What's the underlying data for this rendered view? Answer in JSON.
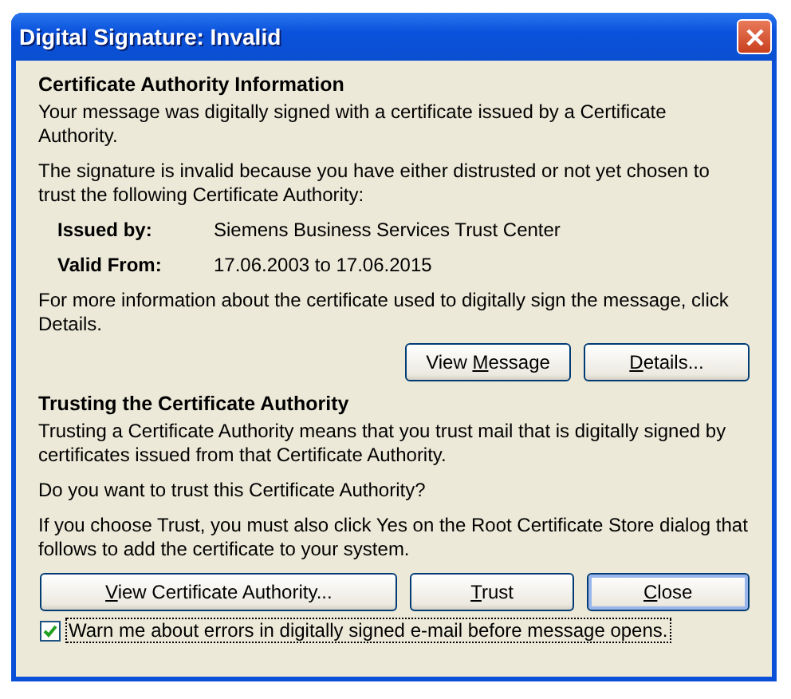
{
  "window": {
    "title": "Digital Signature: Invalid"
  },
  "sections": [
    {
      "heading": "Certificate Authority Information",
      "paragraphs": [
        "Your message was digitally signed with a certificate issued by a Certificate Authority.",
        "The signature is invalid because you have either distrusted or not yet chosen to trust the following Certificate Authority:"
      ],
      "fields": [
        {
          "label": "Issued by:",
          "value": "Siemens Business Services Trust Center"
        },
        {
          "label": "Valid From:",
          "value": "17.06.2003 to 17.06.2015"
        }
      ],
      "note": "For more information about the certificate used to digitally sign the message, click Details.",
      "buttons": [
        {
          "pre": "View ",
          "key": "M",
          "post": "essage",
          "default": false
        },
        {
          "key": "D",
          "post": "etails...",
          "default": false
        }
      ]
    },
    {
      "heading": "Trusting the Certificate Authority",
      "paragraphs": [
        "Trusting a Certificate Authority means that you trust mail that is digitally signed by certificates issued from that Certificate Authority.",
        "Do you want to trust this Certificate Authority?",
        "If you choose Trust, you must also click Yes on the Root Certificate Store dialog that follows to add the certificate to your system."
      ],
      "buttons": [
        {
          "key": "V",
          "post": "iew Certificate Authority...",
          "default": false
        },
        {
          "key": "T",
          "post": "rust",
          "default": false
        },
        {
          "key": "C",
          "post": "lose",
          "default": true
        }
      ]
    }
  ],
  "checkbox": {
    "label": "Warn me about errors in digitally signed e-mail before message opens.",
    "checked": true,
    "focused": true
  }
}
